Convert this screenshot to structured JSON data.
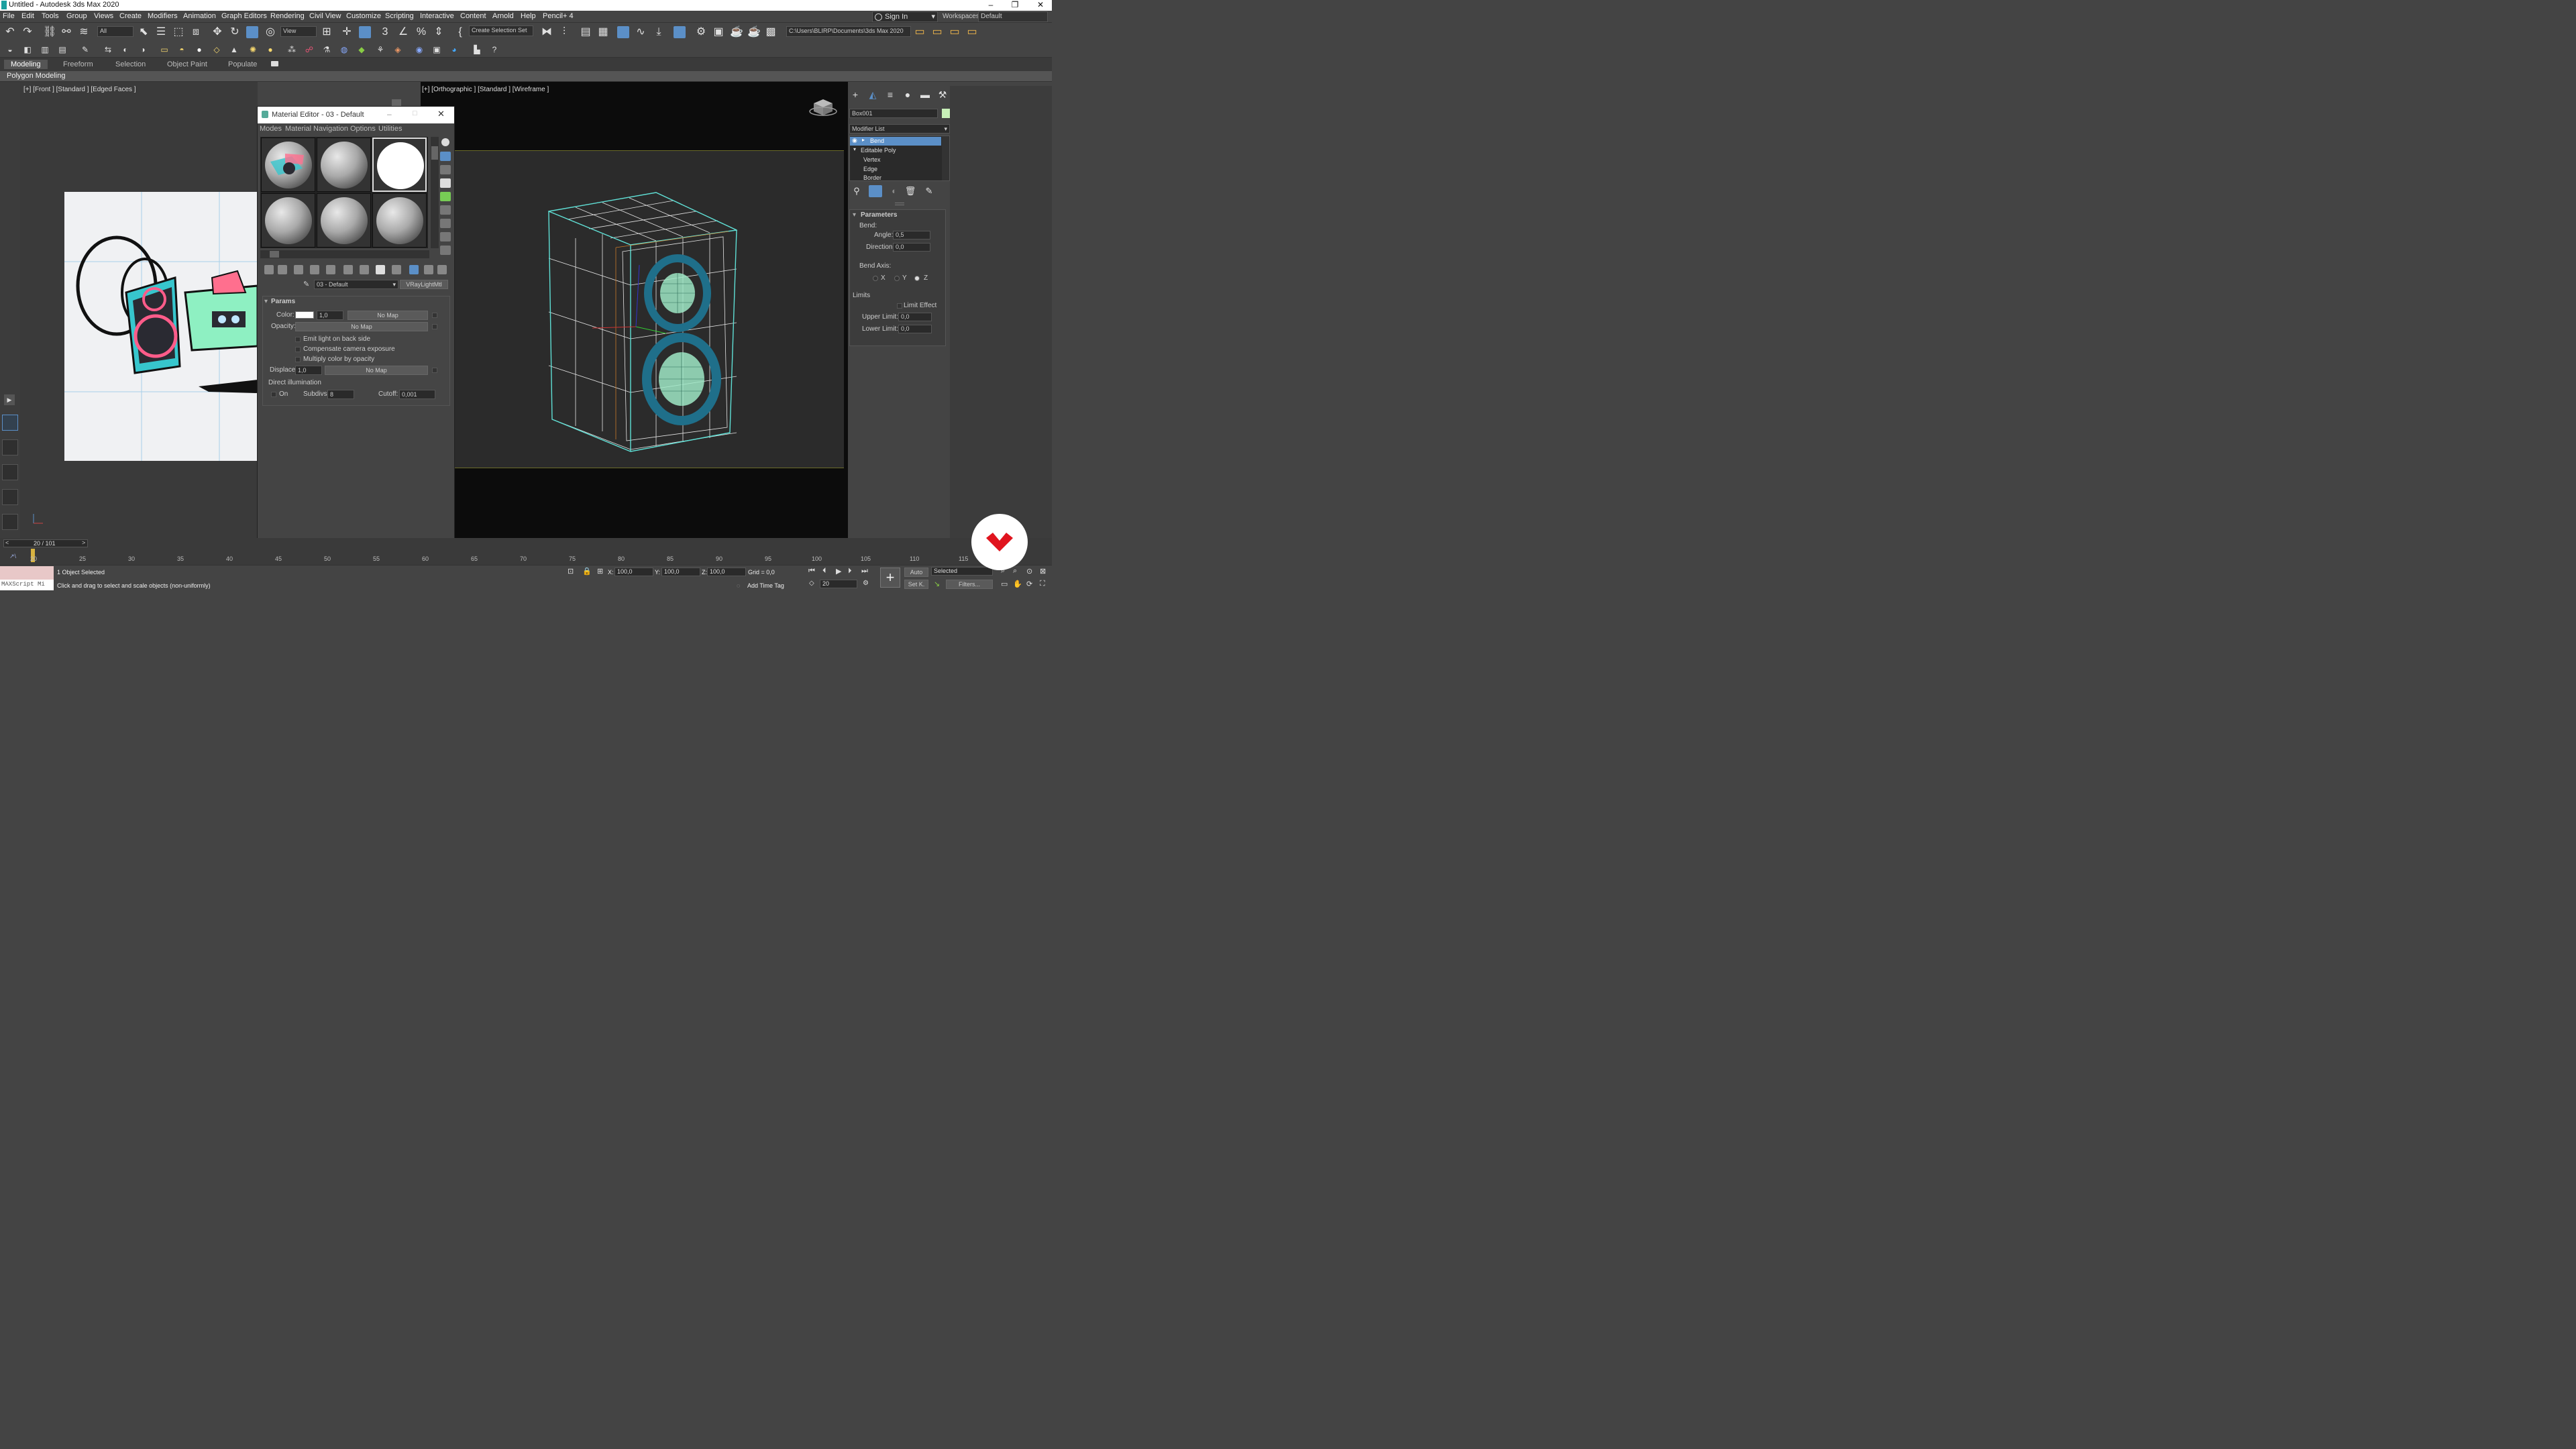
{
  "window": {
    "title": "Untitled - Autodesk 3ds Max 2020",
    "minimize": "–",
    "restore": "❐",
    "close": "✕"
  },
  "menubar": {
    "items": [
      "File",
      "Edit",
      "Tools",
      "Group",
      "Views",
      "Create",
      "Modifiers",
      "Animation",
      "Graph Editors",
      "Rendering",
      "Civil View",
      "Customize",
      "Scripting",
      "Interactive",
      "Content",
      "Arnold",
      "Help",
      "Pencil+ 4"
    ],
    "sign_in": "Sign In",
    "workspaces_label": "Workspaces:",
    "workspace_value": "Default"
  },
  "toolbar": {
    "selection_filter": "All",
    "reference_coord": "View",
    "angle_snap": "3",
    "named_selection": "Create Selection Set",
    "project_path": "C:\\Users\\BLIRP\\Documents\\3ds Max 2020"
  },
  "ribbon": {
    "tabs": [
      "Modeling",
      "Freeform",
      "Selection",
      "Object Paint",
      "Populate"
    ],
    "sub_label": "Polygon Modeling"
  },
  "viewports": {
    "front_label": "[+] [Front ] [Standard ] [Edged Faces ]",
    "ortho_label": "[+] [Orthographic ] [Standard ] [Wireframe ]"
  },
  "material_editor": {
    "title": "Material Editor - 03 - Default",
    "menus": [
      "Modes",
      "Material",
      "Navigation",
      "Options",
      "Utilities"
    ],
    "material_name": "03 - Default",
    "material_type": "VRayLightMtl",
    "rollout_title": "Params",
    "color_label": "Color:",
    "color_value": "1,0",
    "color_map": "No Map",
    "opacity_label": "Opacity:",
    "opacity_map": "No Map",
    "options": [
      "Emit light on back side",
      "Compensate camera exposure",
      "Multiply color by opacity"
    ],
    "displace_label": "Displace:",
    "displace_value": "1,0",
    "displace_map": "No Map",
    "direct_illum_label": "Direct illumination",
    "on_label": "On",
    "subdivs_label": "Subdivs:",
    "subdivs_value": "8",
    "cutoff_label": "Cutoff:",
    "cutoff_value": "0,001"
  },
  "command_panel": {
    "object_name": "Box001",
    "modifier_list_label": "Modifier List",
    "stack": [
      "Bend",
      "Editable Poly",
      "Vertex",
      "Edge",
      "Border"
    ],
    "params_title": "Parameters",
    "bend_label": "Bend:",
    "angle_label": "Angle:",
    "angle_value": "0,5",
    "direction_label": "Direction:",
    "direction_value": "0,0",
    "bend_axis_label": "Bend Axis:",
    "axes": [
      "X",
      "Y",
      "Z"
    ],
    "selected_axis": "Z",
    "limits_label": "Limits",
    "limit_effect": "Limit Effect",
    "upper_label": "Upper Limit:",
    "upper_value": "0,0",
    "lower_label": "Lower Limit:",
    "lower_value": "0,0"
  },
  "timeline": {
    "frame_display": "20 / 101",
    "ticks": [
      "20",
      "25",
      "30",
      "35",
      "40",
      "45",
      "50",
      "55",
      "60",
      "65",
      "70",
      "75",
      "80",
      "85",
      "90",
      "95",
      "100",
      "105",
      "110",
      "115"
    ]
  },
  "status": {
    "maxscript": "MAXScript Mi",
    "selection": "1 Object Selected",
    "hint": "Click and drag to select and scale objects (non-uniformly)",
    "x_label": "X:",
    "x_value": "100,0",
    "y_label": "Y:",
    "y_value": "100,0",
    "z_label": "Z:",
    "z_value": "100,0",
    "grid": "Grid = 0,0",
    "add_time_tag": "Add Time Tag",
    "auto_key": "Auto",
    "set_key": "Set K.",
    "key_filter": "Selected",
    "filters": "Filters...",
    "current_frame": "20"
  },
  "colors": {
    "accent": "#5b8fc7",
    "wire_cyan": "#5fe0d6",
    "wire_white": "#e6e6e6",
    "badge_red": "#e0141e"
  }
}
